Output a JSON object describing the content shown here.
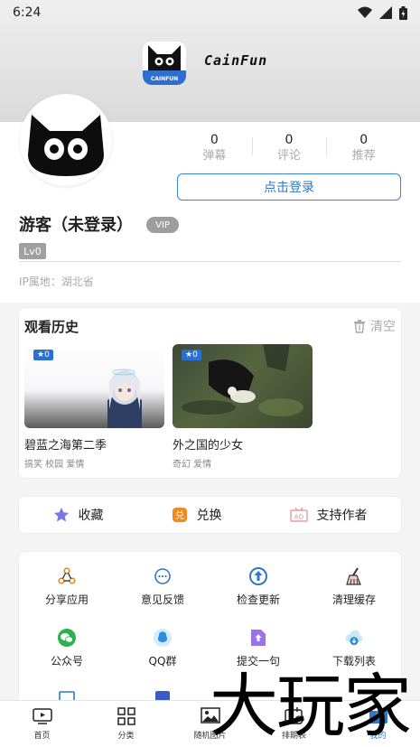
{
  "status_bar": {
    "time": "6:24"
  },
  "app": {
    "name": "CainFun",
    "logo_caption": "CAINFUN"
  },
  "profile": {
    "stats": [
      {
        "value": "0",
        "label": "弹幕"
      },
      {
        "value": "0",
        "label": "评论"
      },
      {
        "value": "0",
        "label": "推荐"
      }
    ],
    "login_label": "点击登录",
    "username": "游客（未登录）",
    "vip_label": "VIP",
    "level": "Lv0",
    "ip_location": "IP属地：湖北省"
  },
  "history": {
    "title": "观看历史",
    "clear_label": "清空",
    "items": [
      {
        "badge": "★0",
        "title": "碧蓝之海第二季",
        "tags": "搞笑 校园 爱情"
      },
      {
        "badge": "★0",
        "title": "外之国的少女",
        "tags": "奇幻 爱情"
      }
    ]
  },
  "actions": [
    {
      "label": "收藏",
      "icon": "star-icon"
    },
    {
      "label": "兑换",
      "icon": "exchange-icon"
    },
    {
      "label": "支持作者",
      "icon": "ad-icon"
    }
  ],
  "tools": [
    {
      "label": "分享应用",
      "icon": "share-icon"
    },
    {
      "label": "意见反馈",
      "icon": "feedback-icon"
    },
    {
      "label": "检查更新",
      "icon": "update-icon"
    },
    {
      "label": "清理缓存",
      "icon": "broom-icon"
    },
    {
      "label": "公众号",
      "icon": "wechat-icon"
    },
    {
      "label": "QQ群",
      "icon": "qq-icon"
    },
    {
      "label": "提交一句",
      "icon": "submit-icon"
    },
    {
      "label": "下载列表",
      "icon": "download-icon"
    }
  ],
  "nav": [
    {
      "label": "首页",
      "icon": "tv-icon"
    },
    {
      "label": "分类",
      "icon": "grid-icon"
    },
    {
      "label": "随机图片",
      "icon": "image-icon"
    },
    {
      "label": "排期表",
      "icon": "calendar-icon"
    },
    {
      "label": "我的",
      "icon": "profile-icon"
    }
  ],
  "colors": {
    "accent": "#2f78cc",
    "level_badge": "#a0a0a0",
    "video_badge": "#2a6fd6"
  },
  "watermark": "大玩家"
}
